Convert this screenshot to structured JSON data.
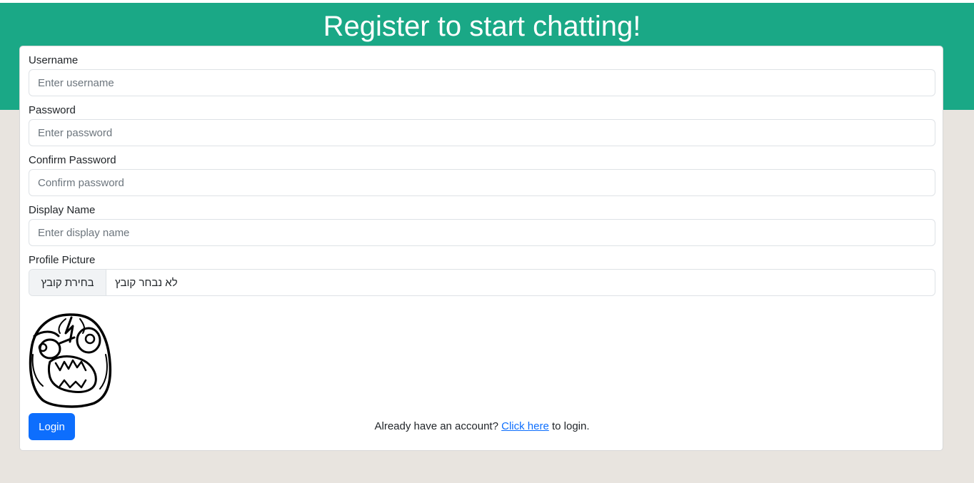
{
  "header": {
    "title": "Register to start chatting!"
  },
  "form": {
    "fields": [
      {
        "label": "Username",
        "placeholder": "Enter username",
        "value": ""
      },
      {
        "label": "Password",
        "placeholder": "Enter password",
        "value": ""
      },
      {
        "label": "Confirm Password",
        "placeholder": "Confirm password",
        "value": ""
      },
      {
        "label": "Display Name",
        "placeholder": "Enter display name",
        "value": ""
      }
    ],
    "profile_picture": {
      "label": "Profile Picture",
      "choose_button": "בחירת קובץ",
      "status": "לא נבחר קובץ"
    },
    "preview_image": "rage-face",
    "login_button": "Login",
    "footer": {
      "prefix": "Already have an account? ",
      "link": "Click here",
      "suffix": " to login."
    }
  },
  "colors": {
    "header": "#1aa886",
    "background": "#e8e4df",
    "primary": "#0d6efd"
  }
}
